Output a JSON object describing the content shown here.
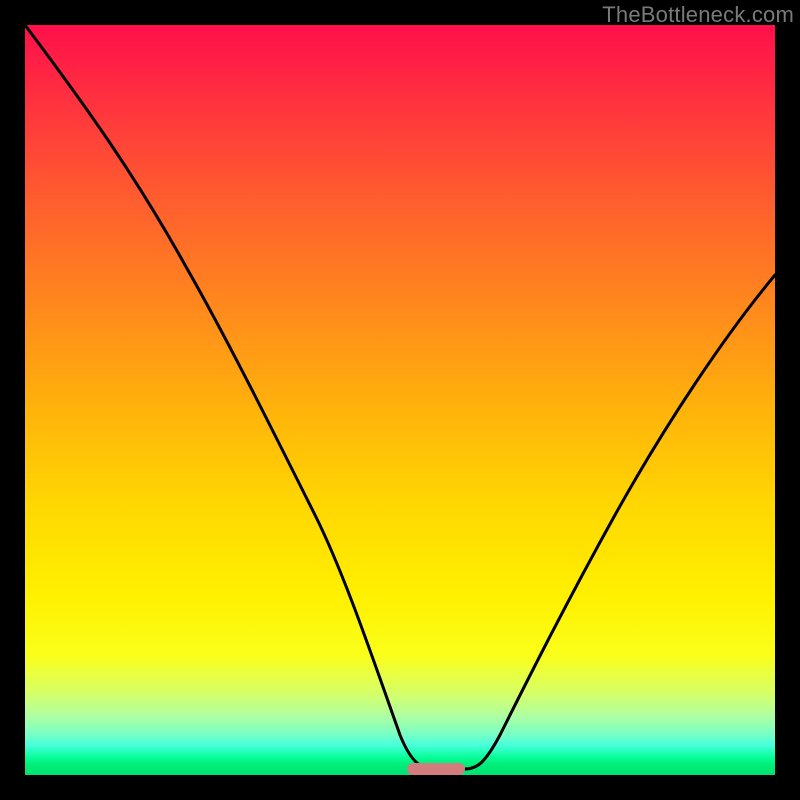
{
  "watermark": {
    "text": "TheBottleneck.com"
  },
  "chart_data": {
    "type": "line",
    "title": "",
    "xlabel": "",
    "ylabel": "",
    "xlim": [
      0,
      100
    ],
    "ylim": [
      0,
      100
    ],
    "grid": false,
    "legend": false,
    "series": [
      {
        "name": "bottleneck-curve",
        "x": [
          0,
          5,
          10,
          15,
          20,
          25,
          30,
          35,
          40,
          45,
          48,
          50,
          52,
          54,
          56,
          58,
          60,
          62,
          65,
          68,
          72,
          76,
          80,
          84,
          88,
          92,
          96,
          100
        ],
        "y": [
          100,
          92,
          84,
          76,
          67,
          58,
          48,
          38,
          27,
          15,
          6,
          1.5,
          0.5,
          0.5,
          0.5,
          0.7,
          1.0,
          2.0,
          6,
          12,
          20,
          28,
          36,
          43,
          50,
          56,
          62,
          67
        ]
      }
    ],
    "marker": {
      "name": "optimum-marker",
      "x_center": 54,
      "y": 0.5,
      "width_pct": 6,
      "color": "#d17d7d"
    },
    "gradient_colors": {
      "top": "#ff104a",
      "mid_orange": "#ff8a1c",
      "mid_yellow": "#fff000",
      "bottom": "#00e070"
    }
  }
}
